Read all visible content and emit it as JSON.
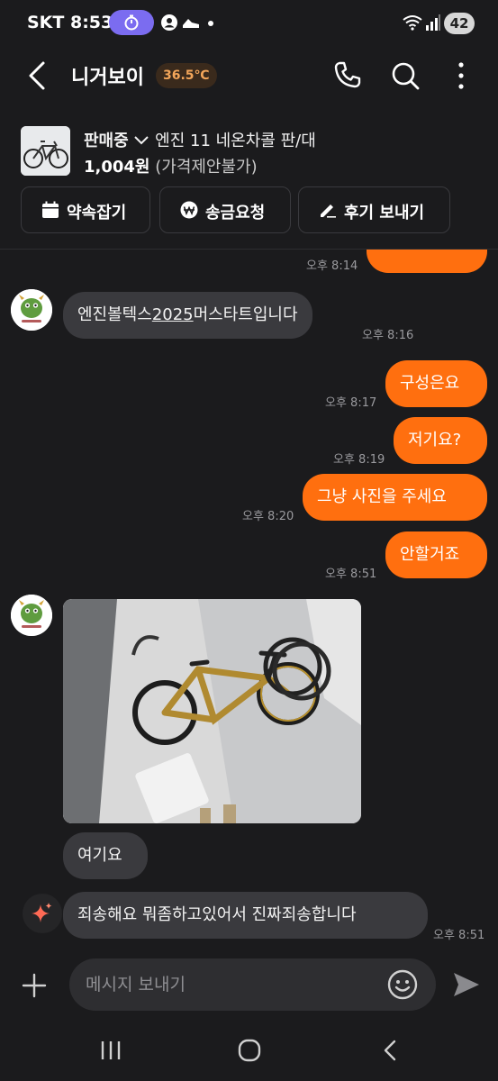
{
  "status": {
    "carrier_time": "SKT 8:53",
    "battery": "42"
  },
  "header": {
    "title": "니거보이",
    "temperature": "36.5℃"
  },
  "product": {
    "status": "판매중",
    "title": "엔진 11 네온차콜 판/대",
    "price": "1,004원",
    "price_note": "(가격제안불가)"
  },
  "actions": [
    {
      "label": "약속잡기",
      "icon": "calendar-icon"
    },
    {
      "label": "송금요청",
      "icon": "won-icon"
    },
    {
      "label": "후기 보내기",
      "icon": "pencil-icon"
    }
  ],
  "messages": {
    "m0": {
      "time": "오후 8:14"
    },
    "m1": {
      "text_a": "엔진볼텍스",
      "text_b": "2025",
      "text_c": "머스타트입니다",
      "time": "오후 8:16"
    },
    "m2": {
      "text": "구성은요",
      "time": "오후 8:17"
    },
    "m3": {
      "text": "저기요?",
      "time": "오후 8:19"
    },
    "m4": {
      "text": "그냥 사진을 주세요",
      "time": "오후 8:20"
    },
    "m5": {
      "text": "안할거죠",
      "time": "오후 8:51"
    },
    "m6": {
      "text": "여기요"
    },
    "m7": {
      "text": "죄송해요 뭐좀하고있어서 진짜죄송합니다",
      "time": "오후 8:51"
    }
  },
  "composer": {
    "placeholder": "메시지 보내기"
  },
  "colors": {
    "accent": "#ff6f0f",
    "background": "#1b1b1d",
    "bubble_other": "#3a3a3e",
    "temperature": "#f3a65a"
  }
}
